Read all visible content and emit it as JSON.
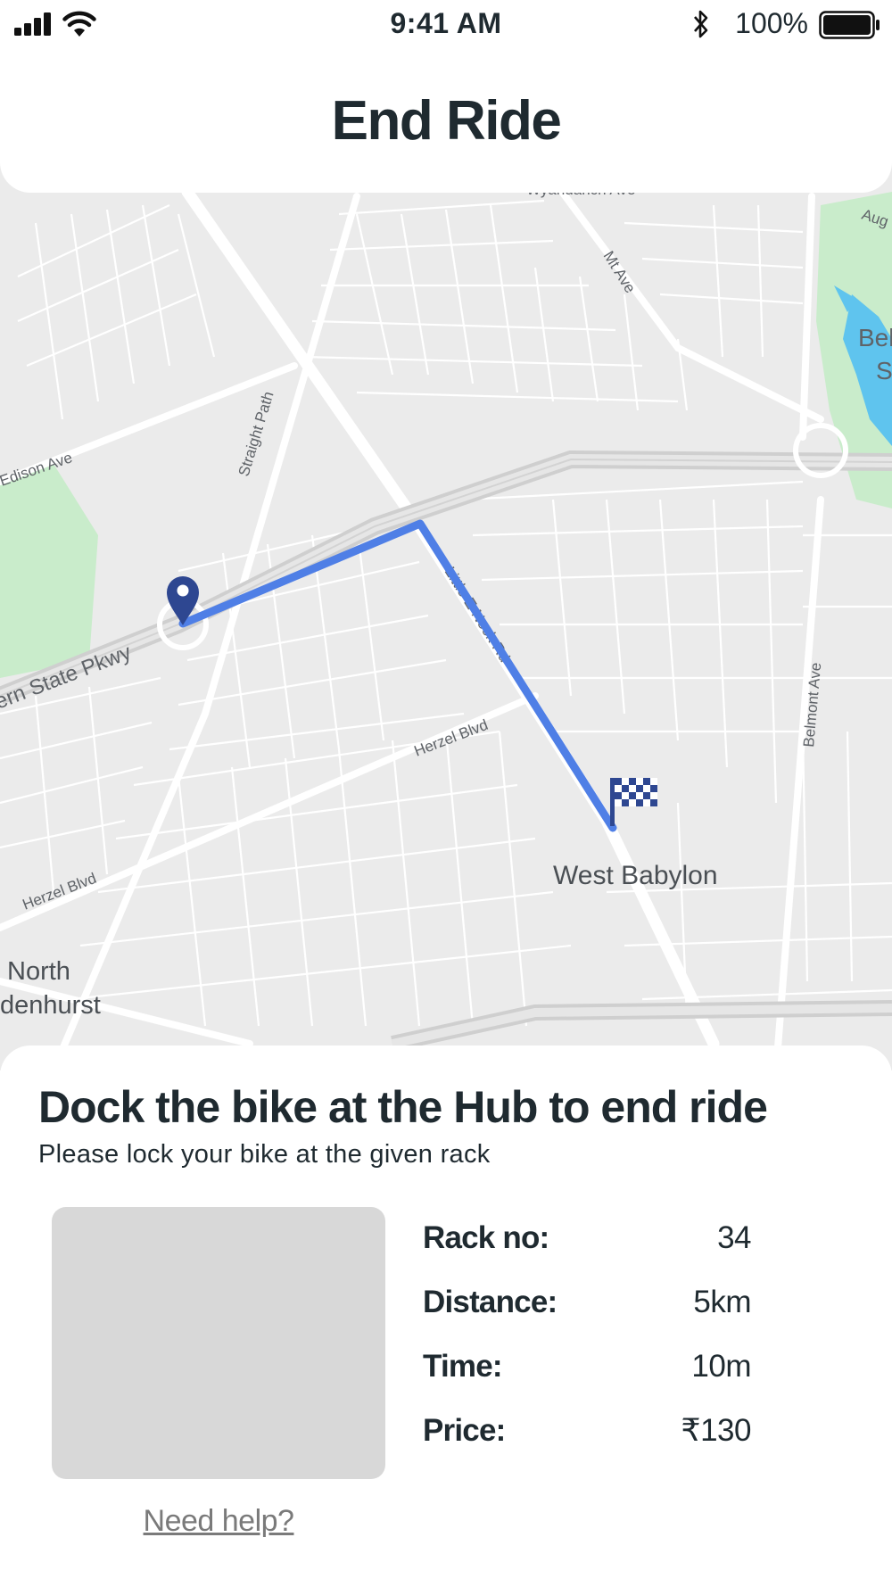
{
  "status_bar": {
    "time": "9:41 AM",
    "battery_percent": "100%",
    "icons": [
      "signal-icon",
      "wifi-icon",
      "bluetooth-icon",
      "battery-icon"
    ]
  },
  "header": {
    "title": "End Ride"
  },
  "map": {
    "street_labels": {
      "wyandanch_ave": "Wyandanch Ave",
      "aug": "Aug",
      "mt_ave": "Mt Ave",
      "bel": "Bel",
      "bel_s": "S",
      "edison_ave": "Edison Ave",
      "straight_path": "Straight Path",
      "state_pkwy": "ern State Pkwy",
      "little_neck": "Little E Neck Rd",
      "herzel_blvd_1": "Herzel Blvd",
      "herzel_blvd_2": "Herzel Blvd",
      "belmont_ave": "Belmont Ave",
      "north": "North",
      "lindenhurst": "denhurst"
    },
    "place_label": "West Babylon",
    "start_marker": "map-pin-icon",
    "end_marker": "checkered-flag-icon",
    "colors": {
      "route": "#4f7fe6",
      "marker": "#2e4791",
      "map_bg": "#ebebeb",
      "park": "#c9eccb",
      "water": "#5fc4ee"
    }
  },
  "sheet": {
    "title": "Dock the bike at the Hub to end ride",
    "subtitle": "Please lock your bike at the given rack",
    "details": [
      {
        "label": "Rack no:",
        "value": "34"
      },
      {
        "label": "Distance:",
        "value": "5km"
      },
      {
        "label": "Time:",
        "value": "10m"
      },
      {
        "label": "Price:",
        "value": "₹130"
      }
    ],
    "help_link": "Need help?"
  }
}
